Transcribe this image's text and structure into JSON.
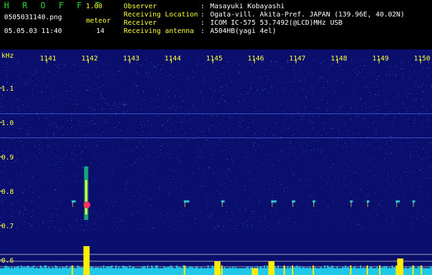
{
  "app": {
    "title_letters": "H R O F F T",
    "version": "1.00",
    "filename": "0505031140.png",
    "datetime": "05.05.03 11:40",
    "meteor_label": "meteor",
    "meteor_count": "14"
  },
  "info": {
    "labels": [
      "Observer",
      "Receiving Location",
      "Receiver",
      "Receiving antenna"
    ],
    "separator": ":",
    "values": [
      "Masayuki Kobayashi",
      "Ogata-vill. Akita-Pref. JAPAN (139.96E, 40.02N)",
      "ICOM IC-575 53.7492(@LCD)MHz USB",
      "A504HB(yagi 4el)"
    ]
  },
  "spectrogram": {
    "unit_label": "kHz",
    "time_ticks": [
      "1141",
      "1142",
      "1143",
      "1144",
      "1145",
      "1146",
      "1147",
      "1148",
      "1149",
      "1150"
    ],
    "freq_ticks": [
      "1.1",
      "1.0",
      "0.9",
      "0.8",
      "0.7",
      "0.6"
    ],
    "colors": {
      "background": "#0a0f6e",
      "noise": "#3b5bff",
      "tick_text": "#ffff33",
      "bars": "#ffee00",
      "floor": "#20c8e8"
    },
    "meteor_minutes": [
      1141.6,
      1142.0,
      1144.3,
      1145.2,
      1146.4,
      1146.7,
      1146.9,
      1147.4,
      1148.3,
      1148.7,
      1149.0,
      1149.4,
      1149.8,
      1150.0
    ]
  }
}
